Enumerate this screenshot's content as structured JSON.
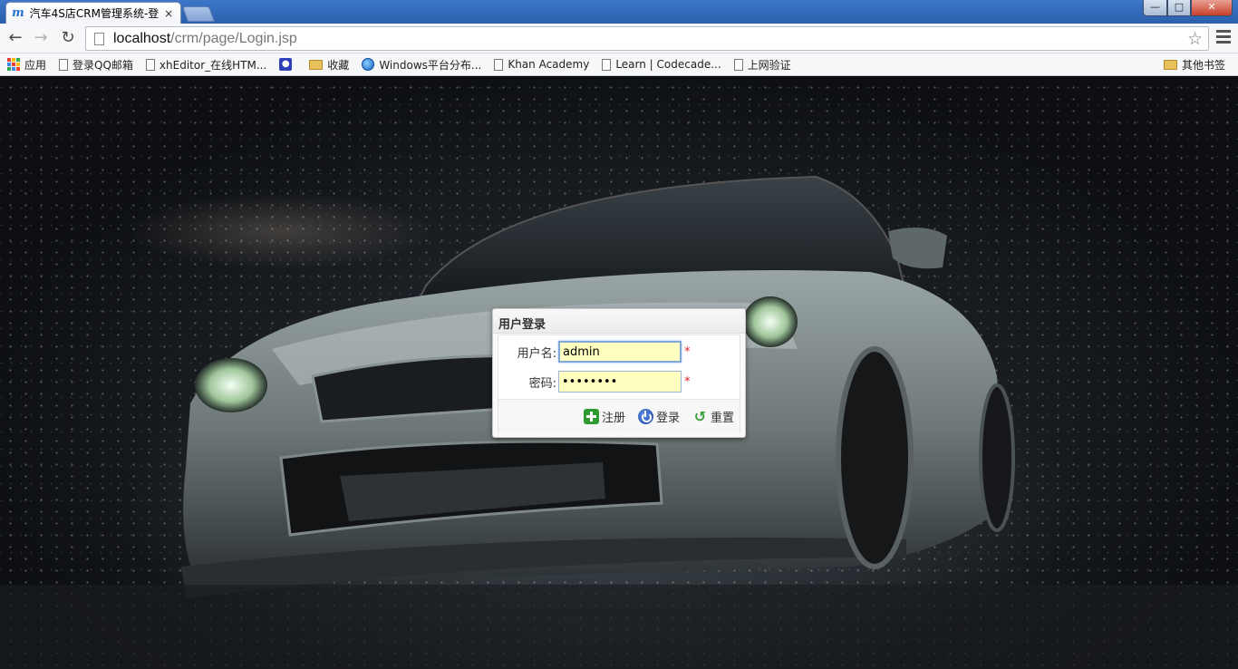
{
  "browser": {
    "tab_title": "汽车4S店CRM管理系统-登",
    "tab_favicon": "m",
    "close_glyph": "×",
    "url_host": "localhost",
    "url_path": "/crm/page/Login.jsp",
    "window_controls": {
      "minimize": "—",
      "maximize": "□",
      "close": "✕"
    }
  },
  "bookmarks": {
    "items": [
      {
        "label": "应用",
        "icon": "apps-icon"
      },
      {
        "label": "登录QQ邮箱",
        "icon": "page-icon"
      },
      {
        "label": "xhEditor_在线HTM...",
        "icon": "page-icon"
      },
      {
        "label": "",
        "icon": "paw-icon"
      },
      {
        "label": "收藏",
        "icon": "folder-icon"
      },
      {
        "label": "Windows平台分布...",
        "icon": "globe-icon"
      },
      {
        "label": "Khan Academy",
        "icon": "page-icon"
      },
      {
        "label": "Learn | Codecade...",
        "icon": "page-icon"
      },
      {
        "label": "上网验证",
        "icon": "page-icon"
      }
    ],
    "other": "其他书签"
  },
  "login": {
    "title": "用户登录",
    "username_label": "用户名:",
    "username_value": "admin",
    "password_label": "密码:",
    "password_value": "••••••••",
    "required_mark": "*",
    "register_label": "注册",
    "login_label": "登录",
    "reset_label": "重置"
  },
  "colors": {
    "input_background": "#ffffc0",
    "required": "#e02020",
    "title_bar": "#3268b8"
  }
}
